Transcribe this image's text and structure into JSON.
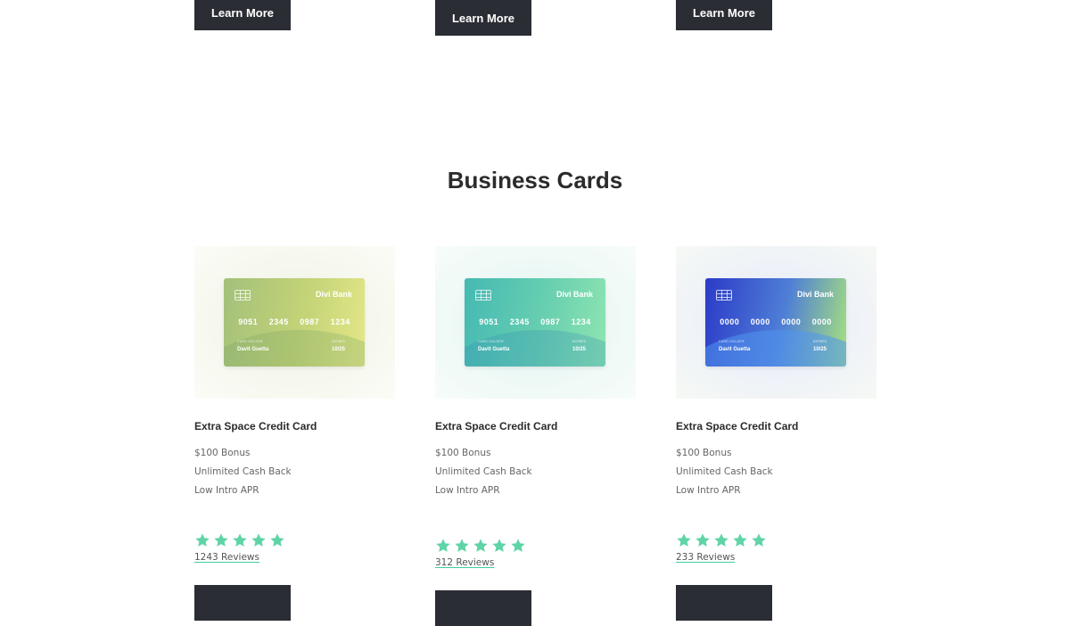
{
  "top_buttons": [
    {
      "label": "Learn More"
    },
    {
      "label": "Learn More"
    },
    {
      "label": "Learn More"
    }
  ],
  "section": {
    "title": "Business Cards"
  },
  "products": [
    {
      "card": {
        "bank": "Divi Bank",
        "number_groups": [
          "9051",
          "2345",
          "0987",
          "1234"
        ],
        "holder_label": "CARD HOLDER",
        "holder": "Davit Guetta",
        "expiry_label": "EXPIRES",
        "expiry": "10/25"
      },
      "title": "Extra Space Credit Card",
      "features": [
        "$100 Bonus",
        "Unlimited Cash Back",
        "Low Intro APR"
      ],
      "rating": 5,
      "reviews": "1243 Reviews"
    },
    {
      "card": {
        "bank": "Divi Bank",
        "number_groups": [
          "9051",
          "2345",
          "0987",
          "1234"
        ],
        "holder_label": "CARD HOLDER",
        "holder": "Davit Guetta",
        "expiry_label": "EXPIRES",
        "expiry": "10/25"
      },
      "title": "Extra Space Credit Card",
      "features": [
        "$100 Bonus",
        "Unlimited Cash Back",
        "Low Intro APR"
      ],
      "rating": 5,
      "reviews": "312 Reviews"
    },
    {
      "card": {
        "bank": "Divi Bank",
        "number_groups": [
          "0000",
          "0000",
          "0000",
          "0000"
        ],
        "holder_label": "CARD HOLDER",
        "holder": "Davit Guetta",
        "expiry_label": "EXPIRES",
        "expiry": "10/25"
      },
      "title": "Extra Space Credit Card",
      "features": [
        "$100 Bonus",
        "Unlimited Cash Back",
        "Low Intro APR"
      ],
      "rating": 5,
      "reviews": "233 Reviews"
    }
  ],
  "colors": {
    "button_bg": "#2a2d33",
    "star": "#5fd4a6",
    "heading": "#2b2b2b"
  },
  "icons": {
    "star": "star-icon",
    "chip": "card-chip-icon"
  }
}
